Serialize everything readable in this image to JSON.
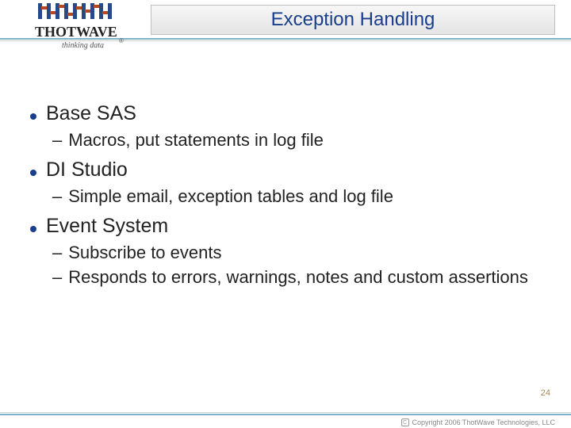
{
  "header": {
    "title": "Exception Handling",
    "logo": {
      "brand": "THOTWAVE",
      "tagline": "thinking data",
      "trademark": "®"
    }
  },
  "bullets": [
    {
      "text": "Base SAS",
      "sub": [
        {
          "text": "Macros, put statements in log file"
        }
      ]
    },
    {
      "text": "DI Studio",
      "sub": [
        {
          "text": "Simple email, exception tables and log file"
        }
      ]
    },
    {
      "text": "Event System",
      "sub": [
        {
          "text": "Subscribe to events"
        },
        {
          "text": "Responds to errors, warnings, notes and custom assertions"
        }
      ]
    }
  ],
  "page_number": "24",
  "footer": {
    "copyright_symbol": "C",
    "copyright_text": "Copyright 2006 ThotWave Technologies, LLC"
  }
}
